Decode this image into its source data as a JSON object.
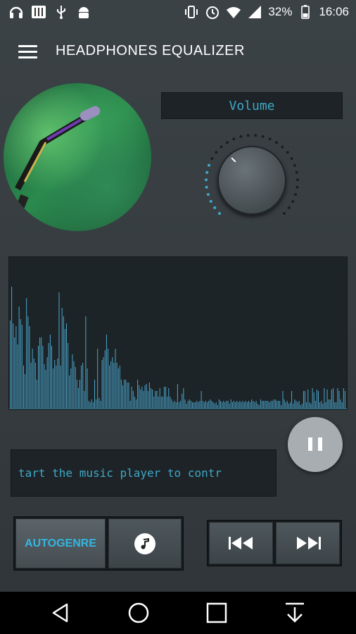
{
  "status_bar": {
    "left_icons": [
      "headphones-icon",
      "equalizer-app-icon",
      "usb-icon",
      "android-debug-icon"
    ],
    "right_icons": [
      "vibrate-icon",
      "alarm-icon",
      "wifi-icon",
      "signal-icon",
      "battery-icon"
    ],
    "battery": "32%",
    "time": "16:06"
  },
  "app_bar": {
    "title": "HEADPHONES EQUALIZER",
    "menu_icon": "hamburger-menu-icon"
  },
  "album_art": {
    "icon": "album-art-microphone"
  },
  "volume": {
    "label": "Volume",
    "level": 0.25
  },
  "spectrum": {
    "values": [
      0.62,
      0.86,
      0.6,
      0.5,
      0.58,
      0.45,
      0.72,
      0.63,
      0.59,
      0.3,
      0.24,
      0.78,
      0.65,
      0.58,
      0.32,
      0.42,
      0.35,
      0.32,
      0.2,
      0.44,
      0.5,
      0.5,
      0.44,
      0.31,
      0.27,
      0.36,
      0.46,
      0.52,
      0.44,
      0.28,
      0.34,
      0.3,
      0.35,
      0.82,
      0.3,
      0.71,
      0.65,
      0.56,
      0.6,
      0.46,
      0.23,
      0.28,
      0.38,
      0.33,
      0.29,
      0.2,
      0.14,
      0.2,
      0.3,
      0.32,
      0.12,
      0.65,
      0.28,
      0.05,
      0.04,
      0.06,
      0.04,
      0.2,
      0.06,
      0.42,
      0.07,
      0.05,
      0.34,
      0.36,
      0.41,
      0.52,
      0.42,
      0.3,
      0.33,
      0.36,
      0.32,
      0.42,
      0.32,
      0.28,
      0.3,
      0.2,
      0.16,
      0.2,
      0.2,
      0.18,
      0.18,
      0.05,
      0.15,
      0.12,
      0.08,
      0.06,
      0.2,
      0.16,
      0.13,
      0.15,
      0.12,
      0.16,
      0.17,
      0.12,
      0.18,
      0.14,
      0.13,
      0.08,
      0.12,
      0.12,
      0.08,
      0.14,
      0.08,
      0.08,
      0.15,
      0.15,
      0.08,
      0.14,
      0.08,
      0.06,
      0.04,
      0.05,
      0.04,
      0.17,
      0.04,
      0.05,
      0.1,
      0.14,
      0.06,
      0.03,
      0.05,
      0.06,
      0.05,
      0.04,
      0.04,
      0.04,
      0.05,
      0.04,
      0.05,
      0.12,
      0.05,
      0.04,
      0.05,
      0.04,
      0.05,
      0.06,
      0.05,
      0.04,
      0.03,
      0.04,
      0.02,
      0.06,
      0.05,
      0.04,
      0.05,
      0.04,
      0.05,
      0.05,
      0.03,
      0.06,
      0.04,
      0.05,
      0.04,
      0.05,
      0.04,
      0.05,
      0.04,
      0.05,
      0.04,
      0.05,
      0.04,
      0.05,
      0.04,
      0.06,
      0.05,
      0.04,
      0.05,
      0.03,
      0.02,
      0.06,
      0.05,
      0.05,
      0.05,
      0.05,
      0.05,
      0.04,
      0.05,
      0.05,
      0.06,
      0.06,
      0.05,
      0.05,
      0.05,
      0.02,
      0.12,
      0.06,
      0.04,
      0.05,
      0.03,
      0.04,
      0.12,
      0.03,
      0.06,
      0.05,
      0.04,
      0.05,
      0.02,
      0.03,
      0.12,
      0.12,
      0.04,
      0.13,
      0.04,
      0.03,
      0.14,
      0.11,
      0.05,
      0.13,
      0.12,
      0.04,
      0.05,
      0.03,
      0.14,
      0.04,
      0.13,
      0.06,
      0.06,
      0.13,
      0.14,
      0.04,
      0.04,
      0.14,
      0.12,
      0.06,
      0.04,
      0.14,
      0.12
    ],
    "color": "#4aa7cf"
  },
  "pause_button": {
    "icon": "pause-icon"
  },
  "ticker_text": "tart the music player to contr",
  "controls": {
    "autogenre_label": "AUTOGENRE",
    "music_icon": "music-note-icon",
    "prev_icon": "rewind-icon",
    "next_icon": "fast-forward-icon"
  },
  "nav_bar": {
    "back_icon": "back-icon",
    "home_icon": "home-icon",
    "recents_icon": "recents-icon",
    "download_icon": "download-icon"
  },
  "colors": {
    "accent": "#3fa8c8",
    "background": "#353b3f"
  }
}
